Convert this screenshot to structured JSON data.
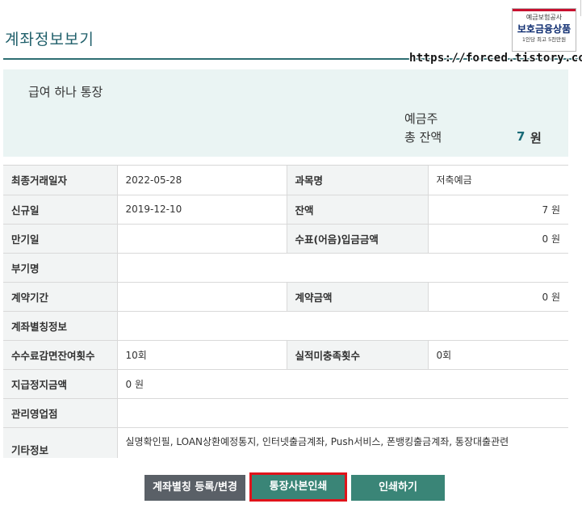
{
  "header": {
    "title": "계좌정보보기",
    "watermark": "https://forced.tistory.com"
  },
  "badge": {
    "line1": "예금보험공사",
    "line2": "보호금융상품",
    "line3": "1인당 최고 5천만원"
  },
  "summary": {
    "account_name": "급여 하나 통장",
    "balance_label_1": "예금주",
    "balance_label_2": "총 잔액",
    "balance_value": "7",
    "balance_unit": "원"
  },
  "details": {
    "last_txn_label": "최종거래일자",
    "last_txn_value": "2022-05-28",
    "subject_label": "과목명",
    "subject_value": "저축예금",
    "opened_label": "신규일",
    "opened_value": "2019-12-10",
    "balance_label": "잔액",
    "balance_value": "7 원",
    "maturity_label": "만기일",
    "maturity_value": "",
    "check_label": "수표(어음)입금금액",
    "check_value": "0 원",
    "extra_label": "부기명",
    "extra_value": "",
    "term_label": "계약기간",
    "term_value": "",
    "contract_amt_label": "계약금액",
    "contract_amt_value": "0 원",
    "alias_label": "계좌별칭정보",
    "alias_value": "",
    "fee_waiver_label": "수수료감면잔여횟수",
    "fee_waiver_value": "10회",
    "unmet_label": "실적미충족횟수",
    "unmet_value": "0회",
    "suspended_label": "지급정지금액",
    "suspended_value": "0 원",
    "branch_label": "관리영업점",
    "branch_value": "",
    "other_label": "기타정보",
    "other_value": "실명확인필,  LOAN상환예정통지,  인터넷출금계좌,  Push서비스,  폰뱅킹출금계좌,  통장대출관련"
  },
  "buttons": {
    "alias": "계좌별칭 등록/변경",
    "copy": "통장사본인쇄",
    "print": "인쇄하기"
  }
}
